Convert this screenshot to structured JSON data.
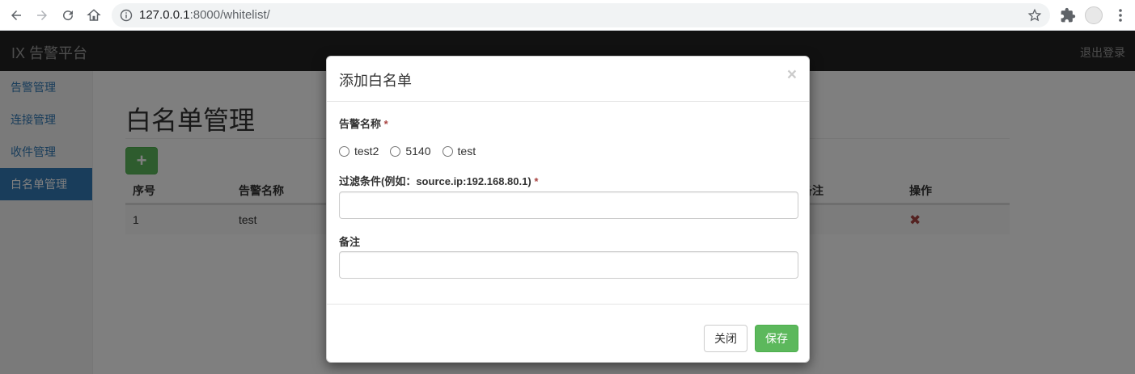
{
  "browser": {
    "url_host": "127.0.0.1",
    "url_path": ":8000/whitelist/",
    "icons": [
      "back-icon",
      "forward-icon",
      "reload-icon",
      "home-icon",
      "info-icon",
      "star-icon",
      "extensions-icon",
      "profile-avatar",
      "menu-icon"
    ]
  },
  "navbar": {
    "brand": "IX 告警平台",
    "logout": "退出登录"
  },
  "sidebar": {
    "items": [
      {
        "label": "告警管理",
        "active": false
      },
      {
        "label": "连接管理",
        "active": false
      },
      {
        "label": "收件管理",
        "active": false
      },
      {
        "label": "白名单管理",
        "active": true
      }
    ]
  },
  "main": {
    "title": "白名单管理",
    "add_label": "+",
    "table": {
      "headers": [
        "序号",
        "告警名称",
        "备注",
        "操作"
      ],
      "rows": [
        {
          "index": "1",
          "name": "test",
          "remark": "",
          "action": "✖"
        }
      ]
    }
  },
  "modal": {
    "title": "添加白名单",
    "close_symbol": "×",
    "alert_name_label": "告警名称",
    "required_mark": "*",
    "radio_options": [
      "test2",
      "5140",
      "test"
    ],
    "filter_label": "过滤条件(例如：source.ip:192.168.80.1)",
    "filter_value": "",
    "remark_label": "备注",
    "remark_value": "",
    "close_button": "关闭",
    "save_button": "保存"
  },
  "colors": {
    "primary": "#337ab7",
    "success": "#5cb85c",
    "danger": "#a94442",
    "navbar": "#222222"
  }
}
